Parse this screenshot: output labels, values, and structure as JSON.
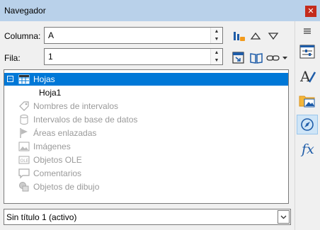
{
  "window": {
    "title": "Navegador",
    "close_icon": "close-icon"
  },
  "column": {
    "label": "Columna:",
    "value": "A"
  },
  "row": {
    "label": "Fila:",
    "value": "1"
  },
  "toolbar": {
    "icons": [
      "toggle-icon",
      "arrow-up-icon",
      "arrow-down-icon",
      "drag-mode-icon",
      "book-icon",
      "link-icon",
      "dropdown-arrow-icon"
    ]
  },
  "tree": {
    "items": [
      {
        "label": "Hojas",
        "icon": "spreadsheet-icon",
        "expanded": true,
        "selected": true,
        "disabled": false
      },
      {
        "label": "Hoja1",
        "icon": "",
        "child": true,
        "selected": false,
        "disabled": false
      },
      {
        "label": "Nombres de intervalos",
        "icon": "tag-icon",
        "disabled": true
      },
      {
        "label": "Intervalos de base de datos",
        "icon": "database-icon",
        "disabled": true
      },
      {
        "label": "Áreas enlazadas",
        "icon": "flag-icon",
        "disabled": true
      },
      {
        "label": "Imágenes",
        "icon": "image-icon",
        "disabled": true
      },
      {
        "label": "Objetos OLE",
        "icon": "ole-icon",
        "disabled": true
      },
      {
        "label": "Comentarios",
        "icon": "comment-icon",
        "disabled": true
      },
      {
        "label": "Objetos de dibujo",
        "icon": "drawing-icon",
        "disabled": true
      }
    ]
  },
  "document_select": {
    "value": "Sin título 1 (activo)"
  },
  "sidebar": {
    "buttons": [
      "menu-icon",
      "properties-icon",
      "styles-icon",
      "gallery-icon",
      "navigator-icon",
      "functions-icon"
    ],
    "functions_label": "fx"
  }
}
